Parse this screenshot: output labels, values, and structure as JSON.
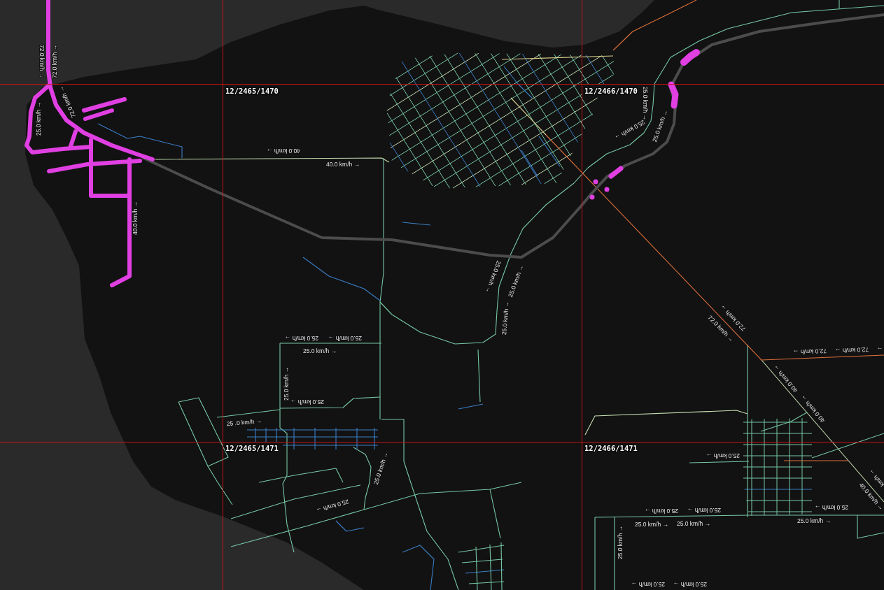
{
  "map": {
    "tile_labels": [
      "12/2465/1470",
      "12/2466/1470",
      "12/2465/1471",
      "12/2466/1471"
    ],
    "speed_labels": [
      "72.0 km/h →",
      "72.0 km/h →",
      "72.0 km/h →",
      "25.0 km/h →",
      "25.0 km/h →",
      "25.0 km/h →",
      "25.0 km/h →",
      "40.0 km/h →",
      "40.0 km/h →",
      "40.0 km/h →",
      "25.0 km/h →",
      "25.0 km/h →",
      "25.0 km/h →",
      "72.0 km/h →",
      "72.0 km/h →",
      "25.0 km/h →",
      "25.0 km/h →",
      "72.0 km/h →",
      "72.0 km/h →",
      "→",
      "25.0 km/h →",
      "40.0 km/h →",
      "25.0 km/h →",
      "25.0 km/h →",
      "40.0 km/h →",
      "25 .0 km/h →",
      "25.0 km/h →",
      "25.0 km/h →",
      "km/h →",
      "40.0 km/h →",
      "25.0 km/h →",
      "25.0 km/h →",
      "25.0 km/h →",
      "25.0 km/h →",
      "25.0 km/h →",
      "25.0 km/h →",
      "25.0 km/h →",
      "25.0 km/h →",
      "25.0 km/h →",
      "25.0 km/h →"
    ]
  }
}
